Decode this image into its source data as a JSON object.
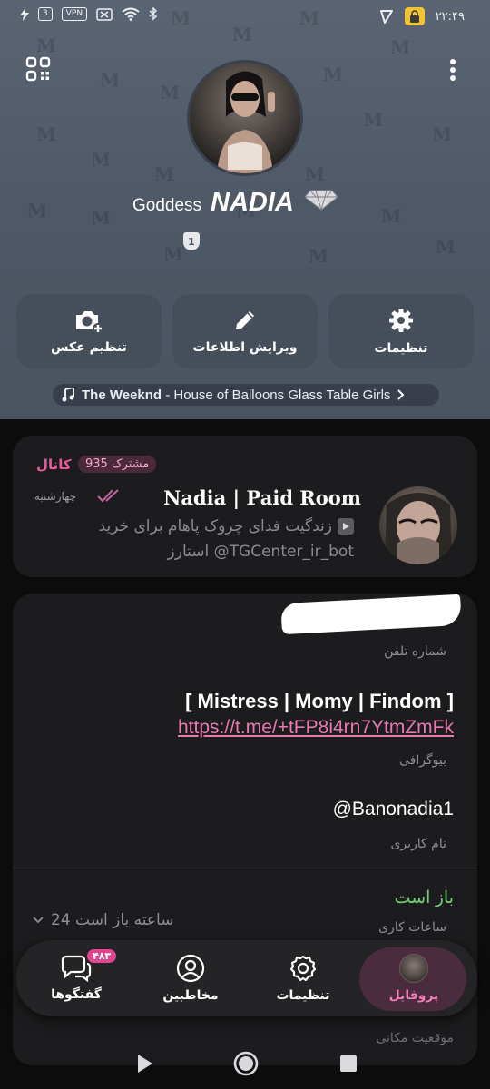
{
  "status_bar": {
    "battery": "3",
    "vpn": "VPN",
    "time": "۲۲:۴۹"
  },
  "profile": {
    "name_prefix": "Goddess",
    "name": "NADIA",
    "badge": "1",
    "avatar": "avatar-photo"
  },
  "actions": [
    {
      "label": "تنظیم عکس",
      "icon": "camera-add-icon"
    },
    {
      "label": "ویرایش اطلاعات",
      "icon": "pencil-icon"
    },
    {
      "label": "تنظیمات",
      "icon": "gear-icon"
    }
  ],
  "music": {
    "artist": "The Weeknd",
    "track": " - House of Balloons Glass Table Girls"
  },
  "channel": {
    "tag": "کانال",
    "subscribers": "935 مشترک",
    "name": "Nadia | Paid Room",
    "day": "چهارشنبه",
    "message_line1": "زندگیت فدای چروک پاهام  برای خرید",
    "message_line2": "استارز @TGCenter_ir_bot"
  },
  "info": {
    "phone_label": "شماره تلفن",
    "bio_title": "[ Mistress | Momy | Findom ]",
    "bio_link": "https://t.me/+tFP8i4rn7YtmZmFk",
    "bio_label": "بیوگرافی",
    "username": "@Banonadia1",
    "username_label": "نام کاربری",
    "open_now": "باز است",
    "hours_value": "24 ساعته باز است",
    "hours_label": "ساعات کاری",
    "location_label": "موقعیت مکانی"
  },
  "nav": [
    {
      "label": "گفتگوها",
      "badge": "۴۸۳",
      "icon": "chat-icon"
    },
    {
      "label": "مخاطبین",
      "icon": "contacts-icon"
    },
    {
      "label": "تنظیمات",
      "icon": "gear-icon"
    },
    {
      "label": "پروفایل",
      "icon": "profile-avatar",
      "active": true
    }
  ],
  "colors": {
    "accent": "#e55c9c",
    "link": "#e87ab0",
    "open_green": "#6fcf6f",
    "header_bg": "#535c6a"
  }
}
